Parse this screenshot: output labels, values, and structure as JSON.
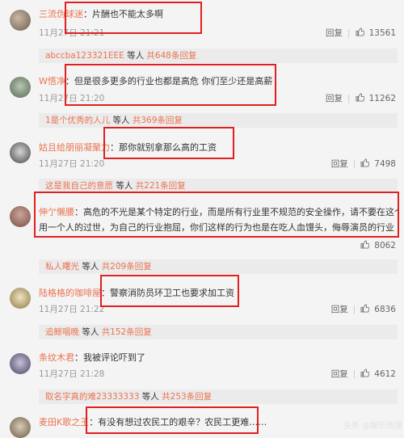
{
  "comments": [
    {
      "user": "三流伪球迷",
      "text": "：片酬也不能太多啊",
      "time": "11月27日 21:21",
      "reply": "回复",
      "likes": "13561",
      "replies": {
        "user": "abccba123321EEE",
        "mid": " 等人 ",
        "count": "共648条回复"
      }
    },
    {
      "user": "W悟净",
      "text": "：但是很多更多的行业也都是高危 你们至少还是高薪",
      "time": "11月27日 21:20",
      "reply": "回复",
      "likes": "11262",
      "replies": {
        "user": "1是个优秀的人儿",
        "mid": " 等人 ",
        "count": "共369条回复"
      }
    },
    {
      "user": "姑且给朋丽凝聚力",
      "text": "：那你就别拿那么高的工资",
      "time": "11月27日 21:20",
      "reply": "回复",
      "likes": "7498",
      "replies": {
        "user": "这是我自己的意愿",
        "mid": " 等人 ",
        "count": "共221条回复"
      }
    },
    {
      "user": "伸亇懒腰",
      "text": "：高危的不光是某个特定的行业，而是所有行业里不规范的安全操作，请不要在这个时候",
      "text2": "用一个人的过世，为自己的行业抱屈，你们这样的行为也是在吃人血馒头，侮辱演员的行业",
      "likes": "8062",
      "replies": {
        "user": "私人曙光",
        "mid": " 等人 ",
        "count": "共209条回复"
      }
    },
    {
      "user": "陆格格的咖啡屋",
      "text": "：警察消防员环卫工也要求加工资",
      "time": "11月27日 21:22",
      "reply": "回复",
      "likes": "6836",
      "replies": {
        "user": "追鲸唱晚",
        "mid": " 等人 ",
        "count": "共152条回复"
      }
    },
    {
      "user": "条纹木君",
      "text": "：我被评论吓到了",
      "time": "11月27日 21:28",
      "reply": "回复",
      "likes": "4612",
      "replies": {
        "user": "取名字真的难23333333",
        "mid": " 等人 ",
        "count": "共253条回复"
      }
    },
    {
      "user": "麦田K歌之王",
      "text": "：有没有想过农民工的艰辛？农民工更难……"
    }
  ],
  "watermark": "头条 @娱乐热搜",
  "colors": {
    "username": "#eb7350",
    "highlight": "#e02020"
  }
}
